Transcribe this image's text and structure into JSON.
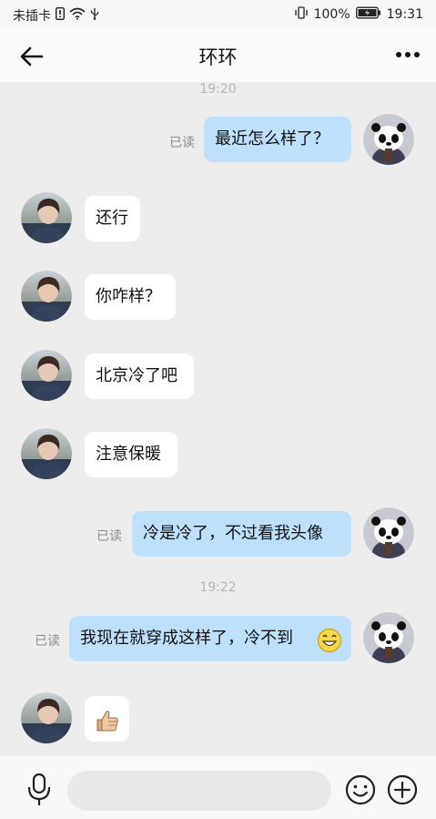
{
  "status": {
    "carrier": "未插卡",
    "battery": "100%",
    "clock": "19:31"
  },
  "header": {
    "title": "环环"
  },
  "timestamps": [
    "19:20",
    "19:22"
  ],
  "messages": [
    {
      "from": "me",
      "text": "最近怎么样了？",
      "read": "已读"
    },
    {
      "from": "them",
      "text": "还行"
    },
    {
      "from": "them",
      "text": "你咋样？"
    },
    {
      "from": "them",
      "text": "北京冷了吧"
    },
    {
      "from": "them",
      "text": "注意保暖"
    },
    {
      "from": "me",
      "text": "冷是冷了，不过看我头像",
      "read": "已读"
    },
    {
      "from": "me",
      "text": "我现在就穿成这样了，冷不到",
      "read": "已读",
      "emoji": "smile-emoji"
    },
    {
      "from": "them",
      "emoji": "thumbs-up-emoji"
    }
  ],
  "input": {
    "value": ""
  },
  "icons": {
    "back": "back-arrow-icon",
    "more": "more-dots-icon",
    "mic": "microphone-icon",
    "emoji": "emoji-icon",
    "plus": "plus-icon"
  },
  "colors": {
    "my_bubble": "#bfe0fb",
    "their_bubble": "#ffffff",
    "background": "#ededed"
  }
}
